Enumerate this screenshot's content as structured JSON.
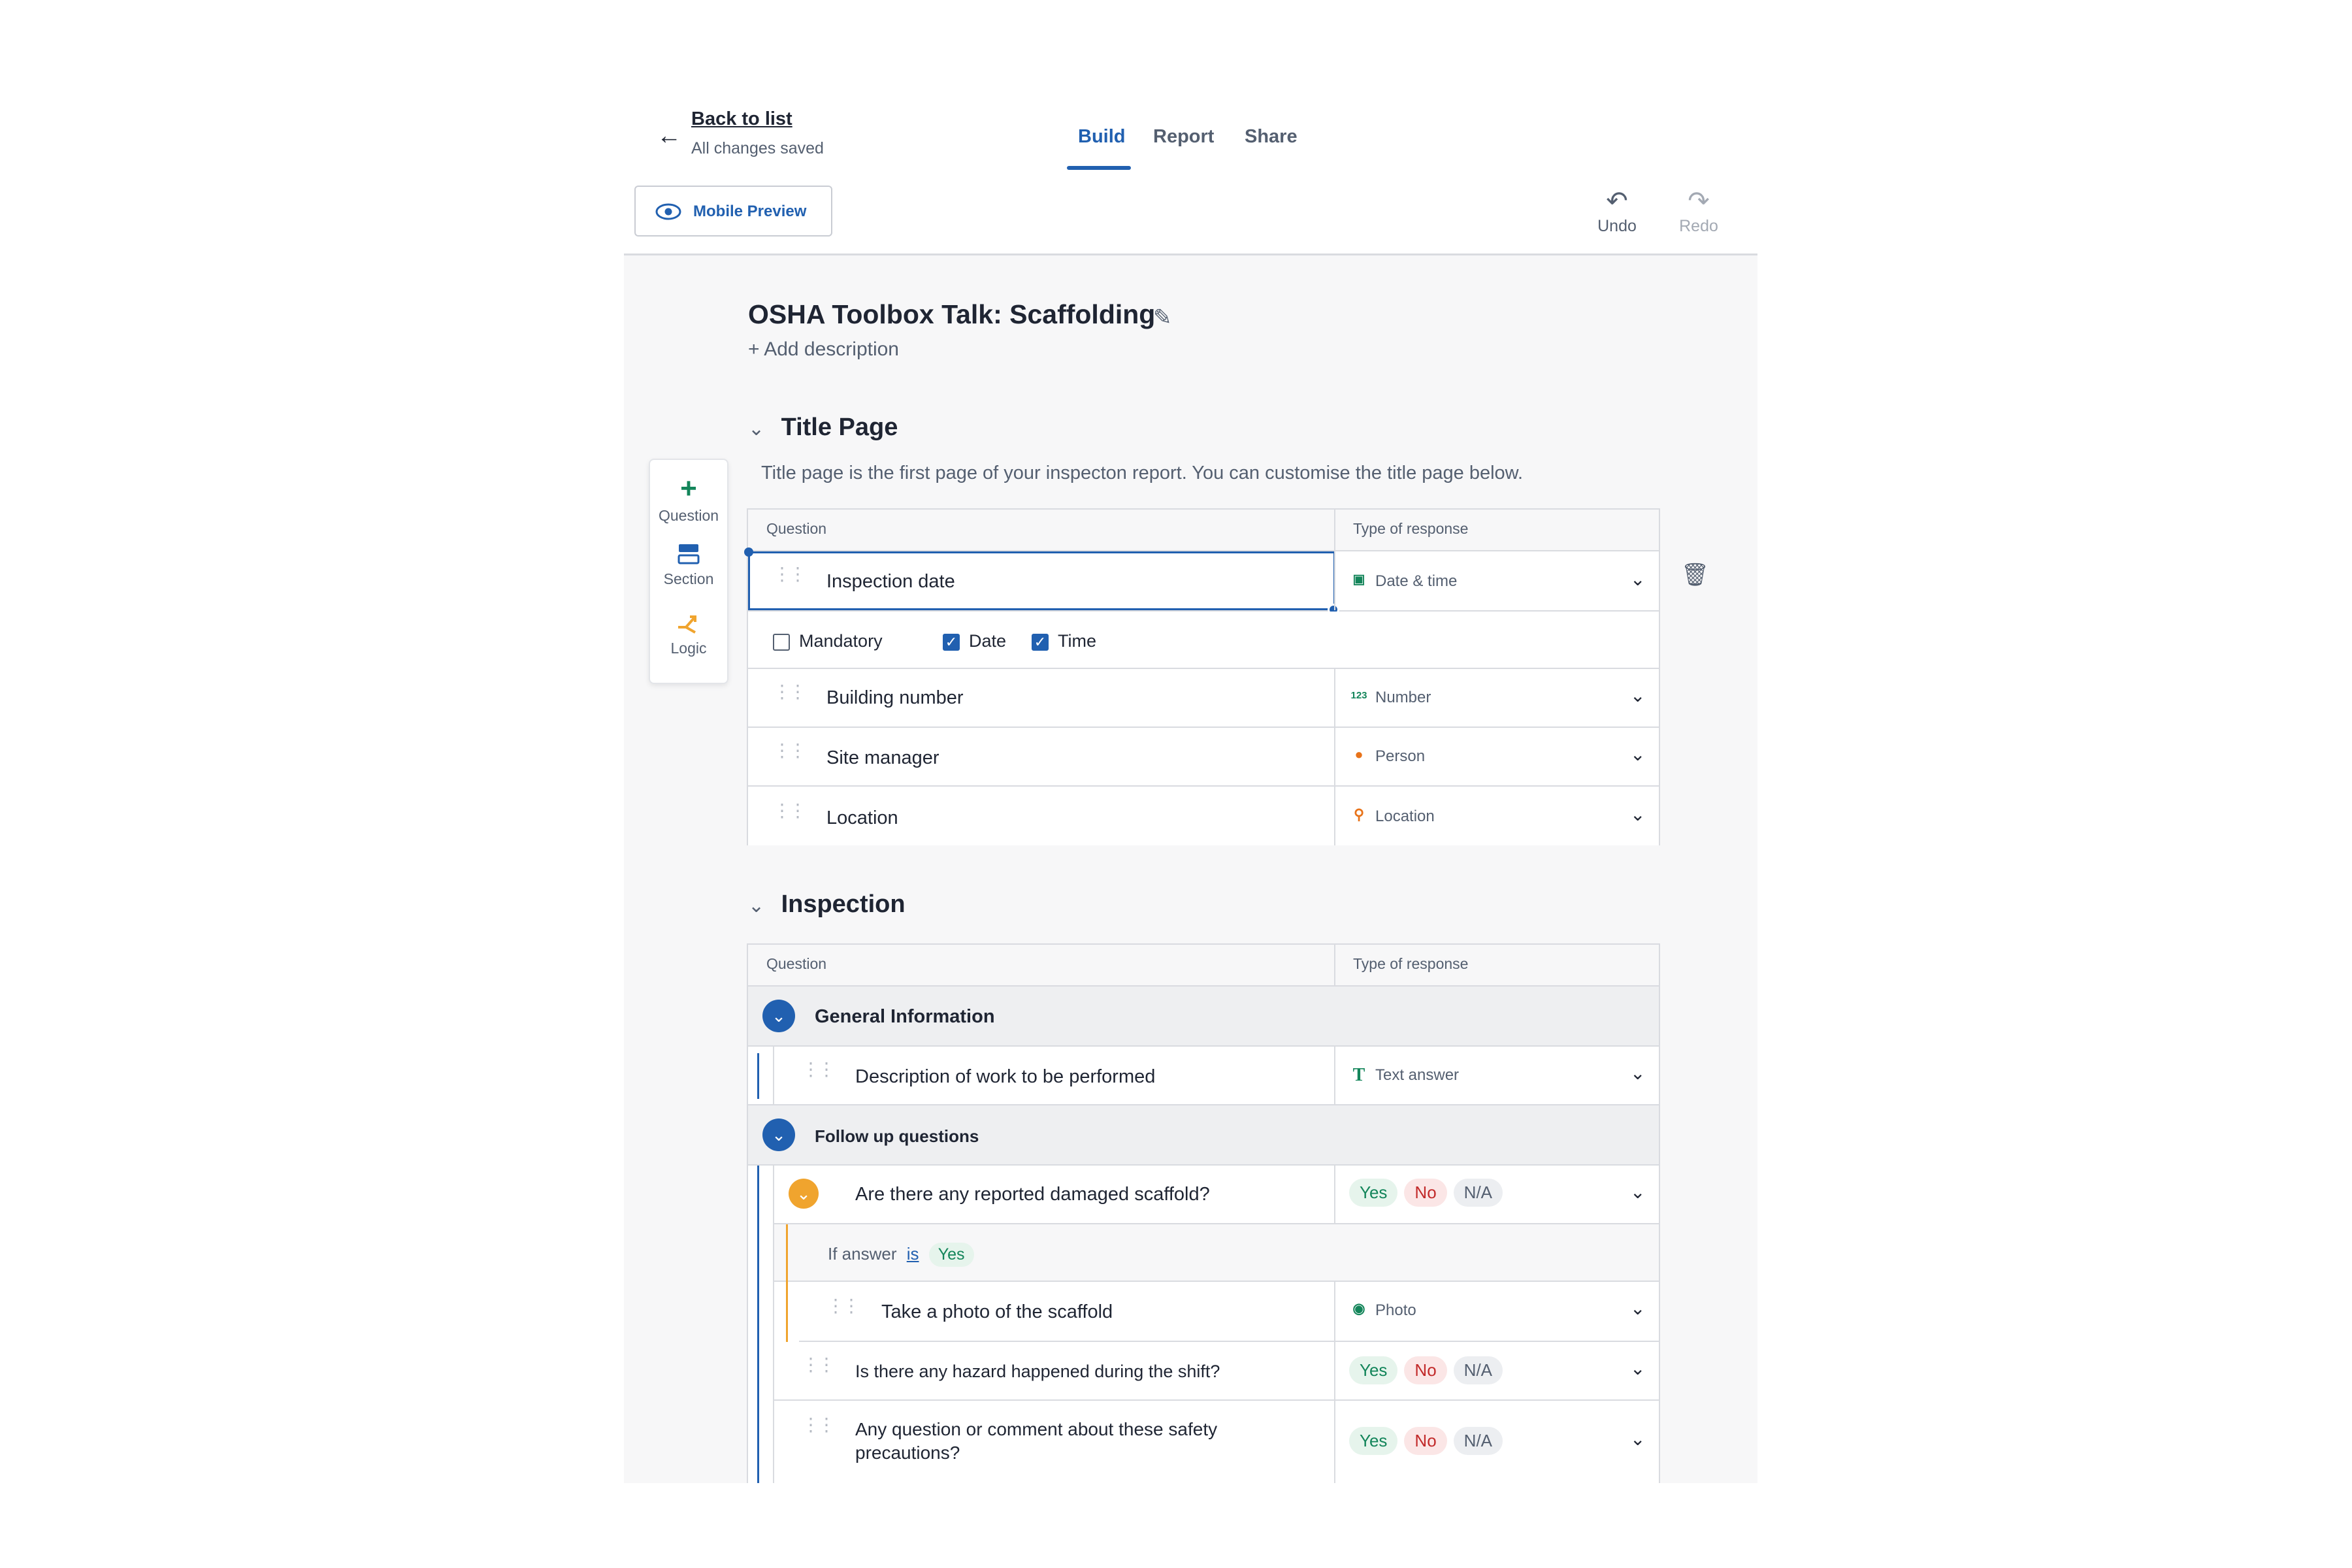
{
  "header": {
    "back_label": "Back to list",
    "saved_status": "All changes saved",
    "tabs": [
      {
        "label": "Build",
        "active": true
      },
      {
        "label": "Report",
        "active": false
      },
      {
        "label": "Share",
        "active": false
      }
    ],
    "preview_label": "Mobile Preview",
    "undo_label": "Undo",
    "redo_label": "Redo"
  },
  "template": {
    "title": "OSHA Toolbox Talk: Scaffolding",
    "add_description": "+ Add description"
  },
  "toolbox": [
    {
      "label": "Question",
      "icon": "plus-icon"
    },
    {
      "label": "Section",
      "icon": "section-icon"
    },
    {
      "label": "Logic",
      "icon": "logic-icon"
    }
  ],
  "title_page": {
    "heading": "Title Page",
    "description": "Title page is the first page of your inspecton report. You can customise the title page below.",
    "col_question": "Question",
    "col_response": "Type of response",
    "rows": [
      {
        "question": "Inspection date",
        "response": "Date & time",
        "icon": "calendar-icon"
      },
      {
        "question": "Building number",
        "response": "Number",
        "icon": "number-icon"
      },
      {
        "question": "Site manager",
        "response": "Person",
        "icon": "person-icon"
      },
      {
        "question": "Location",
        "response": "Location",
        "icon": "location-pin-icon"
      }
    ],
    "options": {
      "mandatory": "Mandatory",
      "date": "Date",
      "time": "Time"
    }
  },
  "inspection": {
    "heading": "Inspection",
    "col_question": "Question",
    "col_response": "Type of response",
    "general_info": "General Information",
    "desc_question": "Description of work to be performed",
    "desc_response": "Text answer",
    "followup": "Follow up questions",
    "q_damaged": "Are there any reported damaged scaffold?",
    "logic_prefix": "If answer",
    "logic_op": "is",
    "logic_value": "Yes",
    "q_photo": "Take a photo of the scaffold",
    "photo_response": "Photo",
    "q_hazard": "Is there any hazard happened during the shift?",
    "q_comment_1": "Any question or comment about these safety",
    "q_comment_2": "precautions?",
    "chip_yes": "Yes",
    "chip_no": "No",
    "chip_na": "N/A",
    "number_glyph": "123"
  },
  "colors": {
    "accent": "#2160b0",
    "green": "#13855a",
    "orange": "#f0a42e",
    "red": "#c22a2a"
  }
}
